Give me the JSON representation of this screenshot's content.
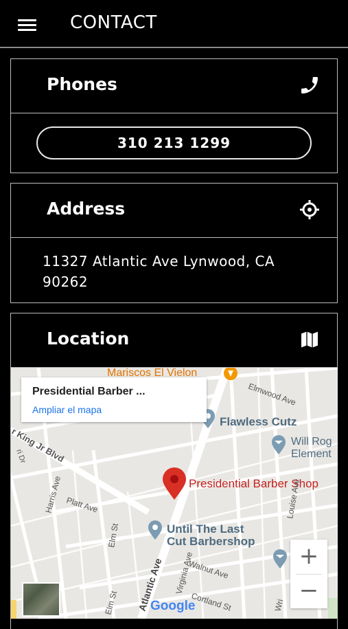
{
  "app": {
    "title": "CONTACT",
    "menu_icon": "hamburger-menu-icon"
  },
  "phones": {
    "title": "Phones",
    "icon": "phone-icon",
    "number": "310 213 1299"
  },
  "address": {
    "title": "Address",
    "icon": "crosshair-location-icon",
    "line1": "11327 Atlantic Ave Lynwood, CA",
    "line2": "90262"
  },
  "location": {
    "title": "Location",
    "icon": "map-icon",
    "map": {
      "place_card_title": "Presidential Barber ...",
      "place_card_link": "Ampliar el mapa",
      "labels": {
        "mariscos": "Mariscos El Vielon",
        "elmwood": "Elmwood Ave",
        "flawless": "Flawless Cutz",
        "will_rog": "Will Rog",
        "element": "Element",
        "mlk": "r King Jr Blvd",
        "presidential": "Presidential Barber Shop",
        "harris": "Harris Ave",
        "platt": "Platt Ave",
        "elm": "Elm St",
        "until1": "Until The Last",
        "until2": "Cut Barbershop",
        "louise": "Louise Ave",
        "walnut": "Walnut Ave",
        "virginia": "Virginia Ave",
        "atlantic": "Atlantic Ave",
        "cortland": "Cortland St",
        "google": "Google",
        "wri": "Wri",
        "ri": "ri Dr"
      },
      "zoom_in": "+",
      "zoom_out": "−",
      "colors": {
        "pin": "#d93025",
        "poi": "#7b9cb3",
        "food": "#f29900",
        "label_red": "#c5221f"
      }
    }
  }
}
